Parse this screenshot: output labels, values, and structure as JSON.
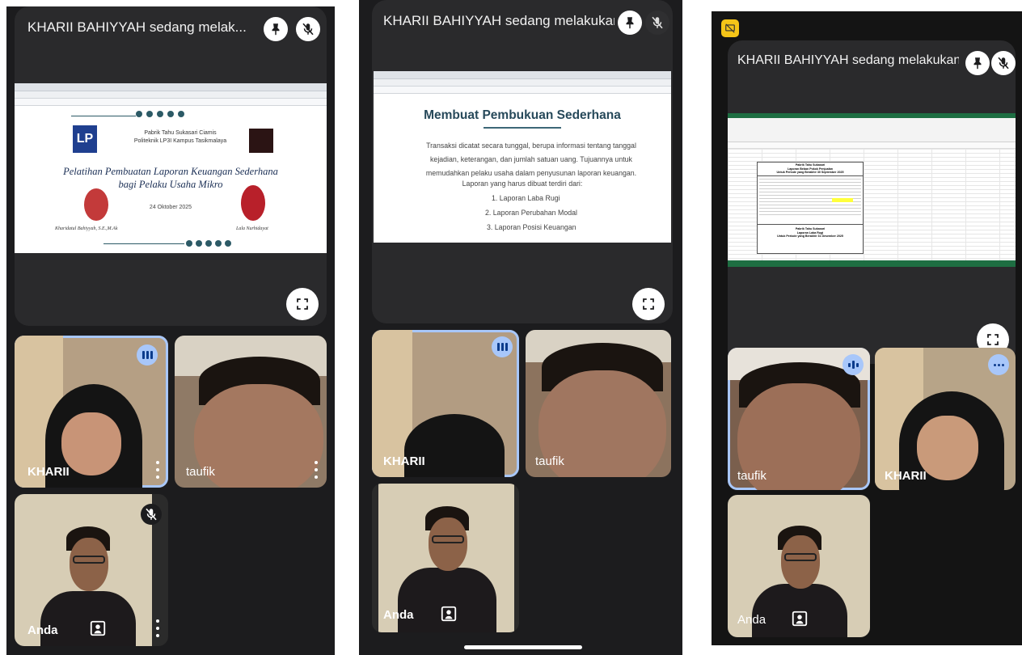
{
  "colors": {
    "phone_bg": "#1c1c1e",
    "active_outline": "#a8c7fa",
    "tile_bg": "#2a2a2c"
  },
  "screen1": {
    "present_title": "KHARII BAHIYYAH sedang melak...",
    "slide": {
      "org_line1": "Pabrik Tahu Sukasari Ciamis",
      "org_line2": "Politeknik LP3I Kampus Tasikmalaya",
      "title_line1": "Pelatihan Pembuatan Laporan Keuangan Sederhana",
      "title_line2": "bagi Pelaku Usaha Mikro",
      "date": "24 Oktober 2025",
      "presenter_left": "Kharidatul Bahiyyah, S.E.,M.Ak",
      "presenter_right": "Lala Nurhidayat"
    },
    "participants": [
      "KHARII",
      "taufik",
      "Anda"
    ]
  },
  "screen2": {
    "present_title": "KHARII BAHIYYAH sedang melakukan pre...",
    "slide": {
      "heading": "Membuat Pembukuan Sederhana",
      "para": "Transaksi dicatat secara tunggal, berupa informasi tentang tanggal kejadian, keterangan, dan jumlah satuan uang. Tujuannya untuk memudahkan pelaku usaha dalam penyusunan laporan keuangan.",
      "list_intro": "Laporan yang harus dibuat terdiri dari:",
      "list": [
        "1.  Laporan Laba Rugi",
        "2.  Laporan Perubahan Modal",
        "3.  Laporan Posisi Keuangan"
      ]
    },
    "participants": [
      "KHARII",
      "taufik",
      "Anda"
    ]
  },
  "screen3": {
    "present_title": "KHARII BAHIYYAH sedang melakukan pre...",
    "sheet": {
      "block1_l1": "Pabrik Tahu Sukasari",
      "block1_l2": "Laporan Beban Pokok Penjualan",
      "block1_l3": "Untuk Periode yang Berakhir 30 September 2025",
      "block2_l1": "Pabrik Tahu Sukasari",
      "block2_l2": "Laporan Laba Rugi",
      "block2_l3": "Untuk Periode yang Berakhir 31 Desember 2025"
    },
    "participants": [
      "taufik",
      "KHARII",
      "Anda"
    ]
  }
}
